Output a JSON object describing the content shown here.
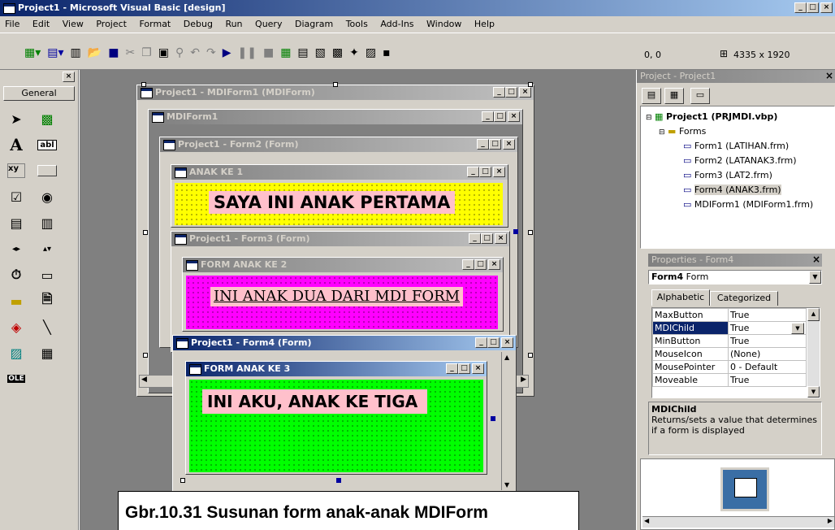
{
  "app": {
    "title": "Project1 - Microsoft Visual Basic [design]"
  },
  "menu": [
    "File",
    "Edit",
    "View",
    "Project",
    "Format",
    "Debug",
    "Run",
    "Query",
    "Diagram",
    "Tools",
    "Add-Ins",
    "Window",
    "Help"
  ],
  "toolbar": {
    "coords": "0, 0",
    "size": "4335 x 1920"
  },
  "toolbox": {
    "tab": "General"
  },
  "mdi_forms": {
    "outer": "Project1 - MDIForm1 (MDIForm)",
    "mdi": "MDIForm1",
    "form2_window": "Project1 - Form2 (Form)",
    "form2_title": "ANAK KE 1",
    "form2_label": "SAYA INI ANAK PERTAMA",
    "form3_window": "Project1 - Form3 (Form)",
    "form3_title": "FORM ANAK KE 2",
    "form3_label": "INI ANAK DUA DARI MDI FORM",
    "form4_window": "Project1 - Form4 (Form)",
    "form4_title": "FORM ANAK KE 3",
    "form4_label": "INI AKU, ANAK KE TIGA"
  },
  "project_explorer": {
    "title": "Project - Project1",
    "project": "Project1 (PRJMDI.vbp)",
    "folder": "Forms",
    "items": [
      "Form1 (LATIHAN.frm)",
      "Form2 (LATANAK3.frm)",
      "Form3 (LAT2.frm)",
      "Form4 (ANAK3.frm)",
      "MDIForm1 (MDIForm1.frm)"
    ]
  },
  "properties": {
    "title": "Properties - Form4",
    "object": "Form4",
    "object_type": "Form",
    "tab_alpha": "Alphabetic",
    "tab_cat": "Categorized",
    "rows": [
      {
        "name": "MaxButton",
        "value": "True"
      },
      {
        "name": "MDIChild",
        "value": "True"
      },
      {
        "name": "MinButton",
        "value": "True"
      },
      {
        "name": "MouseIcon",
        "value": "(None)"
      },
      {
        "name": "MousePointer",
        "value": "0 - Default"
      },
      {
        "name": "Moveable",
        "value": "True"
      }
    ],
    "desc_title": "MDIChild",
    "desc_text": "Returns/sets a value that determines if a form is displayed"
  },
  "caption": "Gbr.10.31 Susunan form anak-anak MDIForm",
  "colors": {
    "yellow": "#ffff00",
    "magenta": "#ff00ff",
    "green": "#00ff00",
    "pink": "#ffc0cb"
  }
}
